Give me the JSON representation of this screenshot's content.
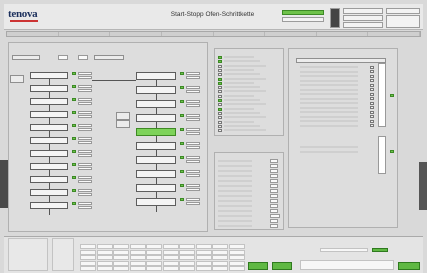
{
  "app": {
    "logo": "tenova",
    "title": "Start-Stopp Ofen-Schrittkette"
  },
  "colors": {
    "active_step": "#7ed35a",
    "accent_green": "#6ec24a",
    "logo_blue": "#1b2f5c",
    "logo_red": "#cc3333"
  },
  "icons": {
    "logo_bar": "red-underline",
    "status_dot": "green-dot"
  }
}
